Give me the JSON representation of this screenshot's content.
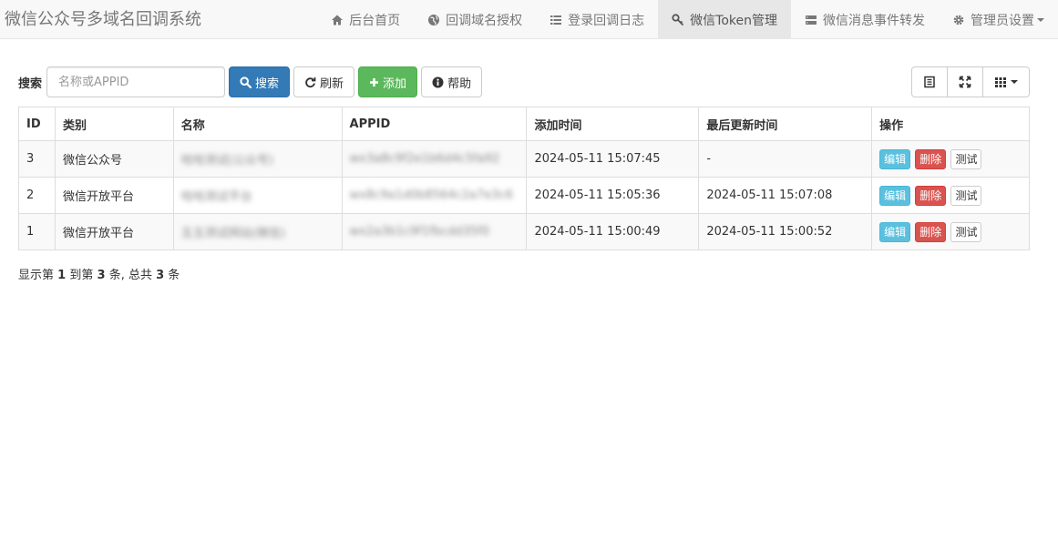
{
  "navbar": {
    "brand": "微信公众号多域名回调系统",
    "items": [
      {
        "label": "后台首页",
        "icon": "home-icon",
        "active": false
      },
      {
        "label": "回调域名授权",
        "icon": "globe-icon",
        "active": false
      },
      {
        "label": "登录回调日志",
        "icon": "list-icon",
        "active": false
      },
      {
        "label": "微信Token管理",
        "icon": "wrench-icon",
        "active": true
      },
      {
        "label": "微信消息事件转发",
        "icon": "server-icon",
        "active": false
      },
      {
        "label": "管理员设置",
        "icon": "gear-icon",
        "active": false,
        "dropdown": true
      }
    ]
  },
  "toolbar": {
    "search_label": "搜索",
    "search_placeholder": "名称或APPID",
    "search_value": "",
    "search_button": "搜索",
    "refresh_button": "刷新",
    "add_button": "添加",
    "help_button": "帮助"
  },
  "right_tools": [
    "toggle-view-icon",
    "fullscreen-icon",
    "columns-icon"
  ],
  "table": {
    "headers": [
      "ID",
      "类别",
      "名称",
      "APPID",
      "添加时间",
      "最后更新时间",
      "操作"
    ],
    "rows": [
      {
        "id": "3",
        "category": "微信公众号",
        "name": "哈哈测试(公众号)",
        "appid": "wx3a8c9f2e1b6d4c5fa92",
        "added": "2024-05-11 15:07:45",
        "updated": "-"
      },
      {
        "id": "2",
        "category": "微信开放平台",
        "name": "哈哈测试平台",
        "appid": "wx8c9a1d0b8564c2a7e3c6",
        "added": "2024-05-11 15:05:36",
        "updated": "2024-05-11 15:07:08"
      },
      {
        "id": "1",
        "category": "微信开放平台",
        "name": "五五测试网站(微信)",
        "appid": "wx2a3b1c9f1fbcdd35f0",
        "added": "2024-05-11 15:00:49",
        "updated": "2024-05-11 15:00:52"
      }
    ],
    "ops": {
      "edit": "编辑",
      "delete": "删除",
      "test": "测试"
    }
  },
  "pagination": {
    "prefix": "显示第",
    "start": "1",
    "mid1": "到第",
    "end": "3",
    "mid2": "条, 总共",
    "total": "3",
    "suffix": "条"
  },
  "colors": {
    "primary": "#337ab7",
    "success": "#5cb85c",
    "info": "#5bc0de",
    "danger": "#d9534f"
  }
}
